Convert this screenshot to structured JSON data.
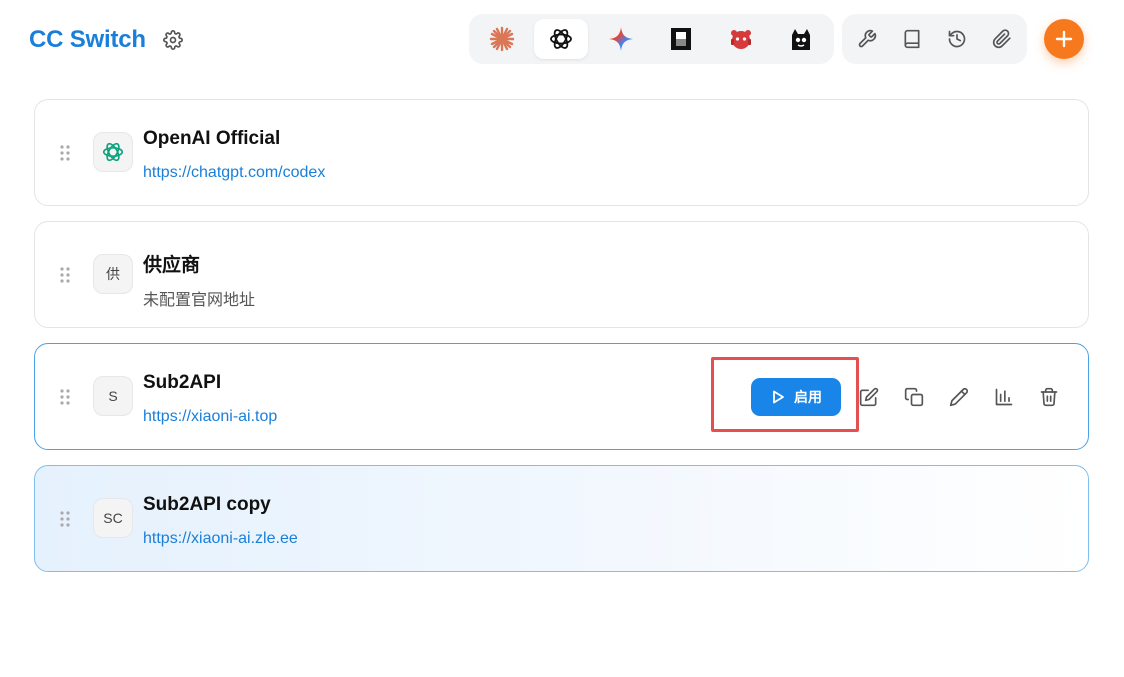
{
  "header": {
    "brand": "CC Switch",
    "settings_icon": "gear-icon",
    "apps": [
      {
        "name": "claude",
        "icon": "claude-burst-icon",
        "active": false
      },
      {
        "name": "codex",
        "icon": "openai-icon",
        "active": true
      },
      {
        "name": "gemini",
        "icon": "gemini-star-icon",
        "active": false
      },
      {
        "name": "opencode",
        "icon": "opencode-icon",
        "active": false
      },
      {
        "name": "red-robot",
        "icon": "red-robot-icon",
        "active": false
      },
      {
        "name": "black-cat",
        "icon": "black-cat-icon",
        "active": false
      }
    ],
    "tools": [
      {
        "icon": "wrench-icon"
      },
      {
        "icon": "book-icon"
      },
      {
        "icon": "history-icon"
      },
      {
        "icon": "paperclip-icon"
      }
    ],
    "add_icon": "plus-icon"
  },
  "colors": {
    "brand": "#1a7fd9",
    "accent": "#1a85e8",
    "add_button": "#f7791e",
    "highlight": "#e54f4f"
  },
  "providers": [
    {
      "name": "OpenAI Official",
      "url": "https://chatgpt.com/codex",
      "avatar": "openai-icon"
    },
    {
      "name": "供应商",
      "url": "未配置官网地址",
      "avatar": "供"
    },
    {
      "name": "Sub2API",
      "url": "https://xiaoni-ai.top",
      "avatar": "S"
    },
    {
      "name": "Sub2API copy",
      "url": "https://xiaoni-ai.zle.ee",
      "avatar": "SC"
    }
  ],
  "actions": {
    "enable_label": "启用",
    "icons": [
      "edit-icon",
      "duplicate-icon",
      "pencil-icon",
      "chart-icon",
      "trash-icon"
    ]
  }
}
